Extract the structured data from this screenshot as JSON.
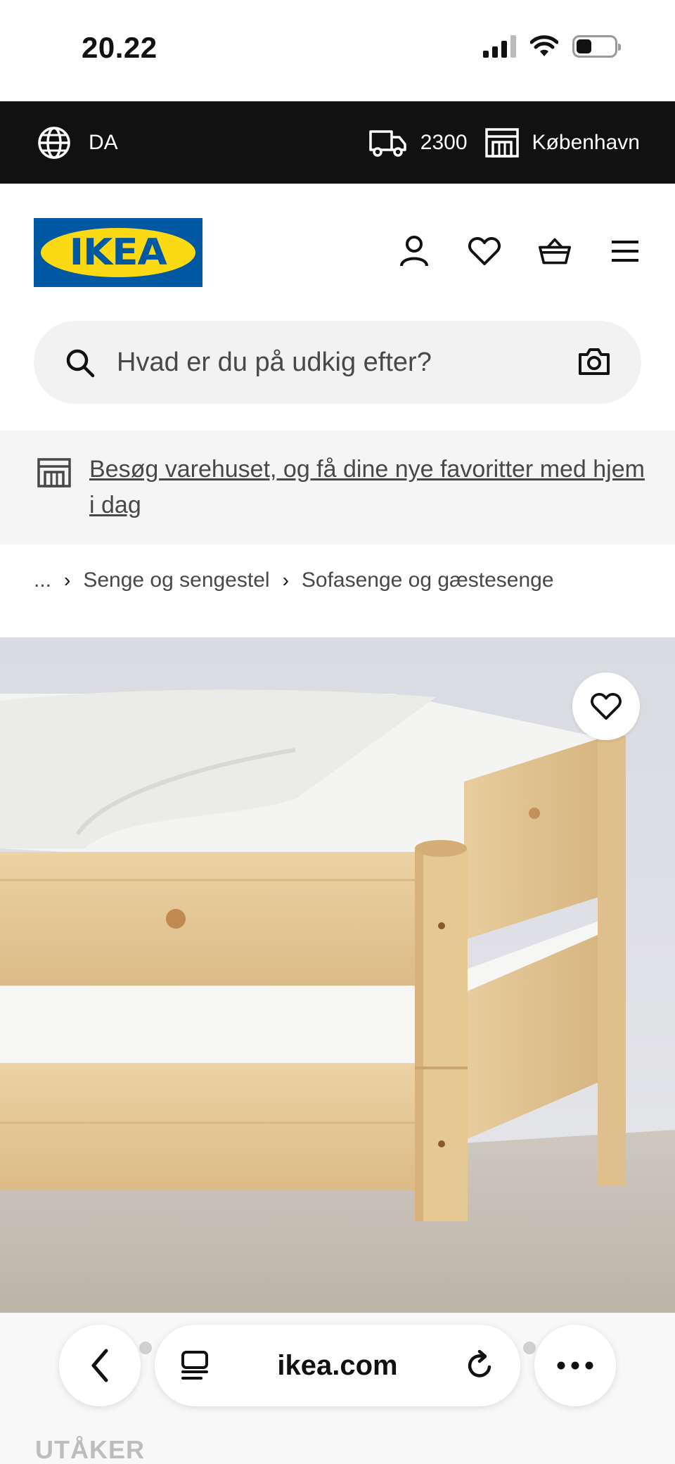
{
  "status_bar": {
    "time": "20.22"
  },
  "topbar": {
    "language": "DA",
    "postcode": "2300",
    "store": "København"
  },
  "header": {
    "logo_text": "IKEA"
  },
  "search": {
    "placeholder": "Hvad er du på udkig efter?"
  },
  "banner": {
    "text": "Besøg varehuset, og få dine nye favoritter med hjem i dag"
  },
  "breadcrumb": {
    "ellipsis": "...",
    "separator": "›",
    "items": [
      "Senge og sengestel",
      "Sofasenge og gæstesenge"
    ]
  },
  "product": {
    "name": "UTÅKER"
  },
  "browser": {
    "url": "ikea.com"
  },
  "colors": {
    "topbar": "#111111",
    "ikea_blue": "#0058a3",
    "ikea_yellow": "#fbd914",
    "pine": "#e6c99a"
  }
}
